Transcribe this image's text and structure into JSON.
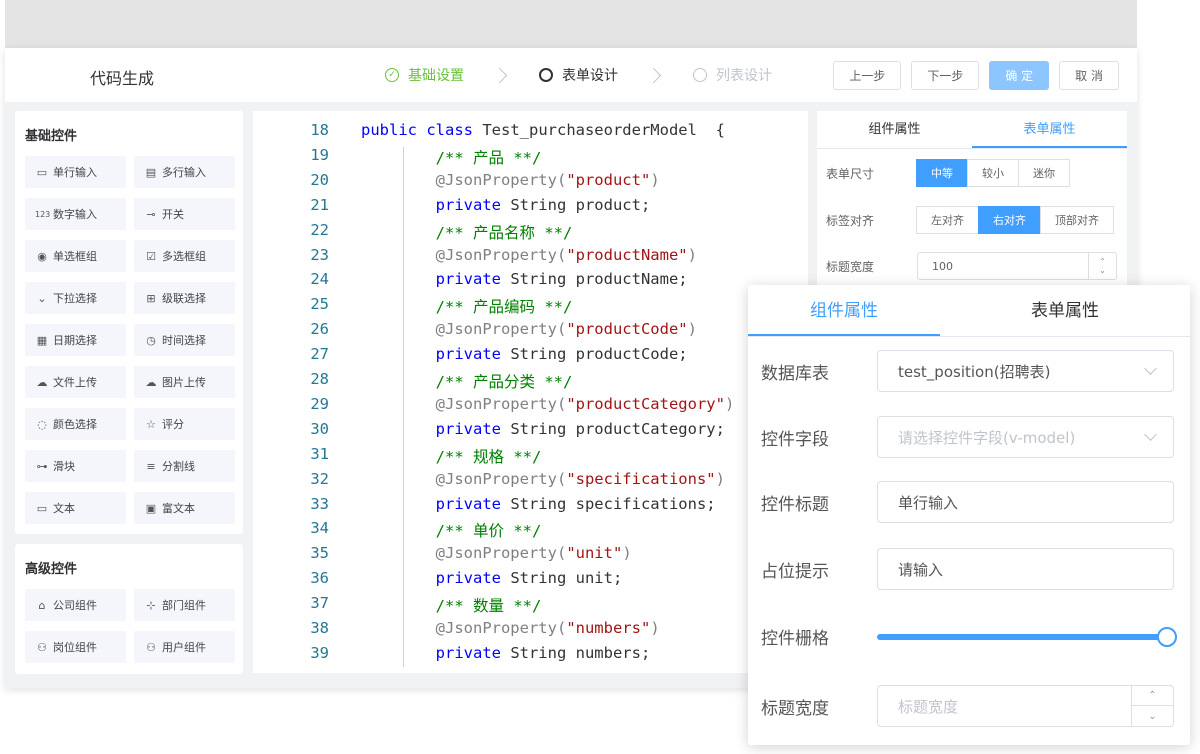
{
  "app": {
    "title": "代码生成"
  },
  "steps": [
    {
      "label": "基础设置",
      "state": "done"
    },
    {
      "label": "表单设计",
      "state": "active"
    },
    {
      "label": "列表设计",
      "state": "todo"
    }
  ],
  "toolbar": {
    "prev": "上一步",
    "next": "下一步",
    "confirm": "确 定",
    "cancel": "取 消"
  },
  "basic_controls": {
    "title": "基础控件",
    "items": [
      {
        "label": "单行输入",
        "icon": "single-line-input-icon",
        "glyph": "▭"
      },
      {
        "label": "多行输入",
        "icon": "multi-line-input-icon",
        "glyph": "▤"
      },
      {
        "label": "数字输入",
        "icon": "number-input-icon",
        "glyph": "123"
      },
      {
        "label": "开关",
        "icon": "switch-icon",
        "glyph": "⊸"
      },
      {
        "label": "单选框组",
        "icon": "radio-group-icon",
        "glyph": "◉"
      },
      {
        "label": "多选框组",
        "icon": "checkbox-group-icon",
        "glyph": "☑"
      },
      {
        "label": "下拉选择",
        "icon": "dropdown-select-icon",
        "glyph": "⌄"
      },
      {
        "label": "级联选择",
        "icon": "cascader-icon",
        "glyph": "⊞"
      },
      {
        "label": "日期选择",
        "icon": "date-picker-icon",
        "glyph": "▦"
      },
      {
        "label": "时间选择",
        "icon": "time-picker-icon",
        "glyph": "◷"
      },
      {
        "label": "文件上传",
        "icon": "file-upload-icon",
        "glyph": "☁"
      },
      {
        "label": "图片上传",
        "icon": "image-upload-icon",
        "glyph": "☁"
      },
      {
        "label": "颜色选择",
        "icon": "color-picker-icon",
        "glyph": "◌"
      },
      {
        "label": "评分",
        "icon": "rate-star-icon",
        "glyph": "☆"
      },
      {
        "label": "滑块",
        "icon": "slider-icon",
        "glyph": "⊶"
      },
      {
        "label": "分割线",
        "icon": "divider-icon",
        "glyph": "≡"
      },
      {
        "label": "文本",
        "icon": "text-icon",
        "glyph": "▭"
      },
      {
        "label": "富文本",
        "icon": "rich-text-icon",
        "glyph": "▣"
      }
    ]
  },
  "advanced_controls": {
    "title": "高级控件",
    "items": [
      {
        "label": "公司组件",
        "icon": "company-icon",
        "glyph": "⌂"
      },
      {
        "label": "部门组件",
        "icon": "department-icon",
        "glyph": "⊹"
      },
      {
        "label": "岗位组件",
        "icon": "position-icon",
        "glyph": "⚇"
      },
      {
        "label": "用户组件",
        "icon": "user-icon",
        "glyph": "⚇"
      }
    ]
  },
  "code": {
    "lines": [
      {
        "n": "18",
        "indent": "",
        "parts": [
          [
            "kw",
            "public class "
          ],
          [
            "tx",
            "Test_purchaseorderModel  {"
          ]
        ]
      },
      {
        "n": "19",
        "indent": "        ",
        "parts": [
          [
            "cm",
            "/** 产品 **/"
          ]
        ]
      },
      {
        "n": "20",
        "indent": "        ",
        "parts": [
          [
            "an",
            "@JsonProperty("
          ],
          [
            "st",
            "\"product\""
          ],
          [
            "an",
            ")"
          ]
        ]
      },
      {
        "n": "21",
        "indent": "        ",
        "parts": [
          [
            "kw",
            "private "
          ],
          [
            "tx",
            "String product;"
          ]
        ]
      },
      {
        "n": "22",
        "indent": "        ",
        "parts": [
          [
            "cm",
            "/** 产品名称 **/"
          ]
        ]
      },
      {
        "n": "23",
        "indent": "        ",
        "parts": [
          [
            "an",
            "@JsonProperty("
          ],
          [
            "st",
            "\"productName\""
          ],
          [
            "an",
            ")"
          ]
        ]
      },
      {
        "n": "24",
        "indent": "        ",
        "parts": [
          [
            "kw",
            "private "
          ],
          [
            "tx",
            "String productName;"
          ]
        ]
      },
      {
        "n": "25",
        "indent": "        ",
        "parts": [
          [
            "cm",
            "/** 产品编码 **/"
          ]
        ]
      },
      {
        "n": "26",
        "indent": "        ",
        "parts": [
          [
            "an",
            "@JsonProperty("
          ],
          [
            "st",
            "\"productCode\""
          ],
          [
            "an",
            ")"
          ]
        ]
      },
      {
        "n": "27",
        "indent": "        ",
        "parts": [
          [
            "kw",
            "private "
          ],
          [
            "tx",
            "String productCode;"
          ]
        ]
      },
      {
        "n": "28",
        "indent": "        ",
        "parts": [
          [
            "cm",
            "/** 产品分类 **/"
          ]
        ]
      },
      {
        "n": "29",
        "indent": "        ",
        "parts": [
          [
            "an",
            "@JsonProperty("
          ],
          [
            "st",
            "\"productCategory\""
          ],
          [
            "an",
            ")"
          ]
        ]
      },
      {
        "n": "30",
        "indent": "        ",
        "parts": [
          [
            "kw",
            "private "
          ],
          [
            "tx",
            "String productCategory;"
          ]
        ]
      },
      {
        "n": "31",
        "indent": "        ",
        "parts": [
          [
            "cm",
            "/** 规格 **/"
          ]
        ]
      },
      {
        "n": "32",
        "indent": "        ",
        "parts": [
          [
            "an",
            "@JsonProperty("
          ],
          [
            "st",
            "\"specifications\""
          ],
          [
            "an",
            ")"
          ]
        ]
      },
      {
        "n": "33",
        "indent": "        ",
        "parts": [
          [
            "kw",
            "private "
          ],
          [
            "tx",
            "String specifications;"
          ]
        ]
      },
      {
        "n": "34",
        "indent": "        ",
        "parts": [
          [
            "cm",
            "/** 单价 **/"
          ]
        ]
      },
      {
        "n": "35",
        "indent": "        ",
        "parts": [
          [
            "an",
            "@JsonProperty("
          ],
          [
            "st",
            "\"unit\""
          ],
          [
            "an",
            ")"
          ]
        ]
      },
      {
        "n": "36",
        "indent": "        ",
        "parts": [
          [
            "kw",
            "private "
          ],
          [
            "tx",
            "String unit;"
          ]
        ]
      },
      {
        "n": "37",
        "indent": "        ",
        "parts": [
          [
            "cm",
            "/** 数量 **/"
          ]
        ]
      },
      {
        "n": "38",
        "indent": "        ",
        "parts": [
          [
            "an",
            "@JsonProperty("
          ],
          [
            "st",
            "\"numbers\""
          ],
          [
            "an",
            ")"
          ]
        ]
      },
      {
        "n": "39",
        "indent": "        ",
        "parts": [
          [
            "kw",
            "private "
          ],
          [
            "tx",
            "String numbers;"
          ]
        ]
      }
    ]
  },
  "form_props": {
    "tabs": [
      "组件属性",
      "表单属性"
    ],
    "active_tab": 1,
    "size": {
      "label": "表单尺寸",
      "options": [
        "中等",
        "较小",
        "迷你"
      ],
      "selected": 0
    },
    "align": {
      "label": "标签对齐",
      "options": [
        "左对齐",
        "右对齐",
        "顶部对齐"
      ],
      "selected": 1
    },
    "label_width": {
      "label": "标题宽度",
      "value": "100",
      "up": "⌃",
      "down": "⌄"
    }
  },
  "component_props": {
    "tabs": [
      "组件属性",
      "表单属性"
    ],
    "active_tab": 0,
    "table": {
      "label": "数据库表",
      "value": "test_position(招聘表)"
    },
    "field": {
      "label": "控件字段",
      "placeholder": "请选择控件字段(v-model)"
    },
    "title": {
      "label": "控件标题",
      "value": "单行输入"
    },
    "placeholder": {
      "label": "占位提示",
      "value": "请输入"
    },
    "grid": {
      "label": "控件栅格",
      "fraction": 1.0
    },
    "label_width": {
      "label": "标题宽度",
      "placeholder": "标题宽度",
      "up": "⌃",
      "down": "⌄"
    }
  },
  "colors": {
    "primary": "#409eff",
    "success": "#67c23a",
    "muted": "#c0c4cc"
  }
}
